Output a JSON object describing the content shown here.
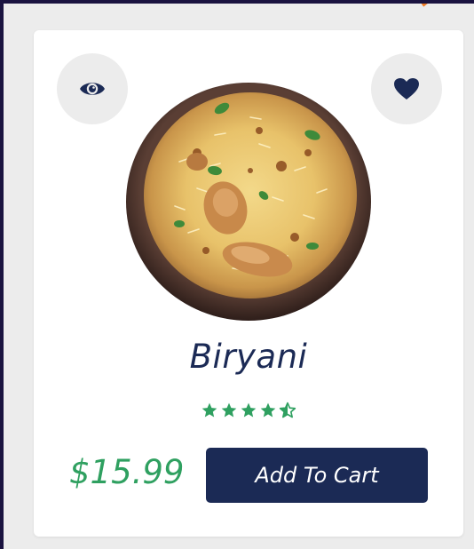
{
  "product": {
    "name": "Biryani",
    "price": "$15.99",
    "rating": 4.5,
    "rating_max": 5,
    "cart_label": "Add To Cart"
  },
  "icons": {
    "view": "eye-icon",
    "favorite": "heart-icon",
    "star": "star-icon"
  },
  "colors": {
    "primary": "#1b2a55",
    "price": "#2fa060",
    "star": "#2fa060",
    "accent": "#f07a22",
    "icon_bg": "#ececec"
  }
}
